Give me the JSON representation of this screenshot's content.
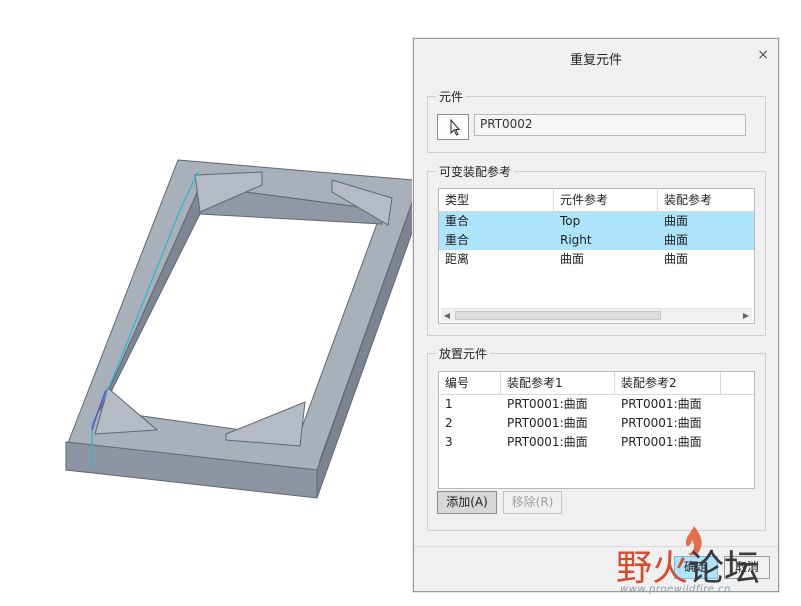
{
  "dialog": {
    "title": "重复元件",
    "close_glyph": "×",
    "component_group": {
      "legend": "元件",
      "selected_part": "PRT0002",
      "select_icon": "arrow-pointer-icon"
    },
    "variable_refs": {
      "legend": "可变装配参考",
      "columns": [
        "类型",
        "元件参考",
        "装配参考"
      ],
      "rows": [
        {
          "type": "重合",
          "comp_ref": "Top",
          "asm_ref": "曲面",
          "selected": true
        },
        {
          "type": "重合",
          "comp_ref": "Right",
          "asm_ref": "曲面",
          "selected": true
        },
        {
          "type": "距离",
          "comp_ref": "曲面",
          "asm_ref": "曲面",
          "selected": false
        }
      ]
    },
    "placement": {
      "legend": "放置元件",
      "columns": [
        "编号",
        "装配参考1",
        "装配参考2"
      ],
      "rows": [
        {
          "num": "1",
          "ref1": "PRT0001:曲面",
          "ref2": "PRT0001:曲面"
        },
        {
          "num": "2",
          "ref1": "PRT0001:曲面",
          "ref2": "PRT0001:曲面"
        },
        {
          "num": "3",
          "ref1": "PRT0001:曲面",
          "ref2": "PRT0001:曲面"
        }
      ],
      "add_label": "添加(A)",
      "remove_label": "移除(R)"
    },
    "ok_label": "确定",
    "cancel_label": "取消"
  },
  "watermark": {
    "red_part": "野火",
    "dark_part": "论坛",
    "url": "www.proewildfire.cn"
  },
  "colors": {
    "selection": "#ade3fb",
    "model_face": "#8e97a3",
    "model_top": "#a6aeb8",
    "edge_highlight": "#29b6d6"
  }
}
